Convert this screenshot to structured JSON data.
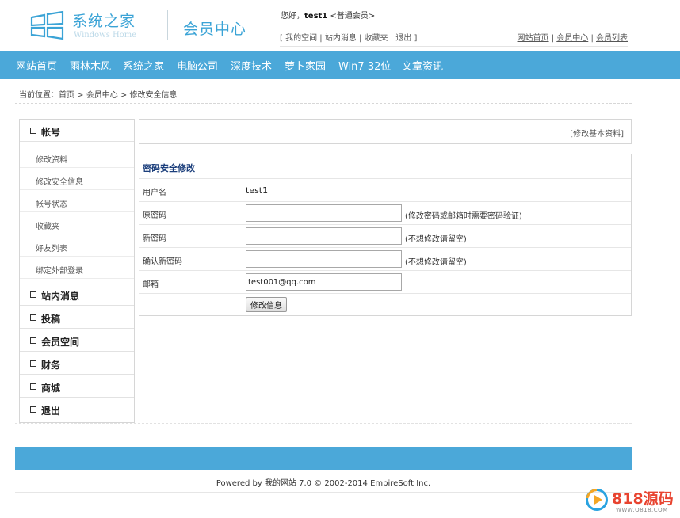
{
  "header": {
    "logo_title": "系统之家",
    "logo_sub": "Windows Home",
    "member_center": "会员中心",
    "greeting_prefix": "您好，",
    "username": "test1",
    "role": "<普通会员>",
    "links": [
      "我的空间",
      "站内消息",
      "收藏夹",
      "退出"
    ],
    "right_links": [
      "网站首页",
      "会员中心",
      "会员列表"
    ]
  },
  "nav": {
    "items": [
      "网站首页",
      "雨林木风",
      "系统之家",
      "电脑公司",
      "深度技术",
      "萝卜家园",
      "Win7 32位",
      "文章资讯"
    ]
  },
  "breadcrumb": {
    "label": "当前位置：",
    "items": [
      "首页",
      "会员中心",
      "修改安全信息"
    ]
  },
  "sidebar": {
    "account": "帐号",
    "sub_items": [
      "修改资料",
      "修改安全信息",
      "帐号状态",
      "收藏夹",
      "好友列表",
      "绑定外部登录"
    ],
    "sections": [
      "站内消息",
      "投稿",
      "会员空间",
      "财务",
      "商城",
      "退出"
    ]
  },
  "topbox": {
    "link": "[修改基本资料]"
  },
  "form": {
    "title": "密码安全修改",
    "username_label": "用户名",
    "username_value": "test1",
    "old_password_label": "原密码",
    "old_password_hint": "(修改密码或邮箱时需要密码验证)",
    "new_password_label": "新密码",
    "new_password_hint": "(不想修改请留空)",
    "confirm_password_label": "确认新密码",
    "confirm_password_hint": "(不想修改请留空)",
    "email_label": "邮箱",
    "email_value": "test001@qq.com",
    "submit_label": "修改信息"
  },
  "footer": {
    "text": "Powered by 我的网站 7.0  © 2002-2014 EmpireSoft Inc."
  },
  "watermark": {
    "name": "818源码",
    "url": "WWW.Q818.COM"
  },
  "colors": {
    "accent": "#4ba8d9",
    "logo": "#3aa3d6",
    "form_title": "#1c3f7c"
  }
}
